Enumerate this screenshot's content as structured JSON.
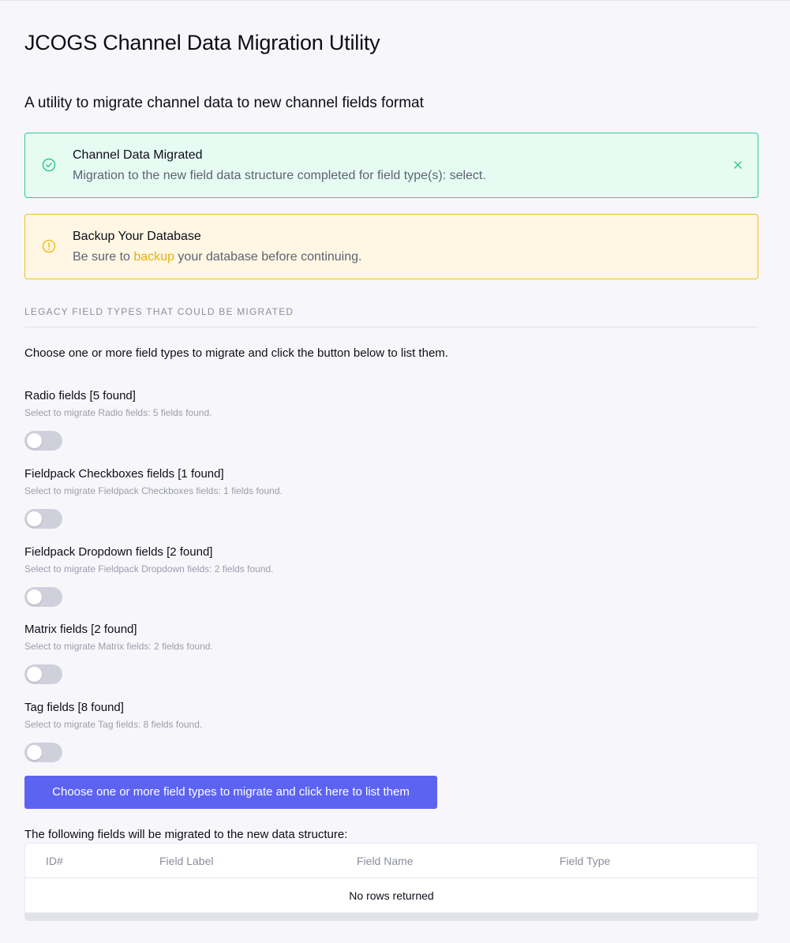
{
  "page": {
    "title": "JCOGS Channel Data Migration Utility",
    "subtitle": "A utility to migrate channel data to new channel fields format"
  },
  "alerts": {
    "success": {
      "title": "Channel Data Migrated",
      "text": "Migration to the new field data structure completed for field type(s): select.",
      "icon": "check-circle-icon",
      "color": "#34c98a"
    },
    "warning": {
      "title": "Backup Your Database",
      "text_before": "Be sure to ",
      "link": "backup",
      "text_after": " your database before continuing.",
      "icon": "exclamation-circle-icon",
      "color": "#f0c020"
    }
  },
  "section": {
    "heading": "LEGACY FIELD TYPES THAT COULD BE MIGRATED",
    "intro": "Choose one or more field types to migrate and click the button below to list them."
  },
  "fields": [
    {
      "label": "Radio fields [5 found]",
      "desc": "Select to migrate Radio fields: 5 fields found.",
      "enabled": false
    },
    {
      "label": "Fieldpack Checkboxes fields [1 found]",
      "desc": "Select to migrate Fieldpack Checkboxes fields: 1 fields found.",
      "enabled": false
    },
    {
      "label": "Fieldpack Dropdown fields [2 found]",
      "desc": "Select to migrate Fieldpack Dropdown fields: 2 fields found.",
      "enabled": false
    },
    {
      "label": "Matrix fields [2 found]",
      "desc": "Select to migrate Matrix fields: 2 fields found.",
      "enabled": false
    },
    {
      "label": "Tag fields [8 found]",
      "desc": "Select to migrate Tag fields: 8 fields found.",
      "enabled": false
    }
  ],
  "button": {
    "label": "Choose one or more field types to migrate and click here to list them",
    "color": "#5d63f1"
  },
  "table": {
    "caption": "The following fields will be migrated to the new data structure:",
    "columns": [
      "ID#",
      "Field Label",
      "Field Name",
      "Field Type"
    ],
    "empty": "No rows returned"
  }
}
